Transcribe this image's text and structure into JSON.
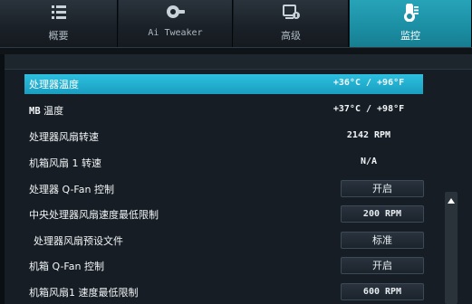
{
  "tabs": [
    {
      "label": "概要",
      "icon": "list-icon",
      "active": false
    },
    {
      "label": "Ai Tweaker",
      "icon": "tweaker-icon",
      "active": false
    },
    {
      "label": "高级",
      "icon": "advanced-icon",
      "active": false
    },
    {
      "label": "监控",
      "icon": "thermometer-icon",
      "active": true
    }
  ],
  "rows": [
    {
      "label": "处理器温度",
      "value": "+36°C / +96°F",
      "selected": true
    },
    {
      "label_prefix": "MB",
      "label": " 温度",
      "value": "+37°C / +98°F"
    },
    {
      "label": "处理器风扇转速",
      "value": "2142 RPM"
    },
    {
      "label": "机箱风扇 1 转速",
      "value": "N/A"
    },
    {
      "label": "处理器 Q-Fan 控制",
      "button": "开启"
    },
    {
      "label": "中央处理器风扇速度最低限制",
      "button": "200 RPM"
    },
    {
      "label": "处理器风扇预设文件",
      "button": "标准"
    },
    {
      "label": "机箱 Q-Fan 控制",
      "button": "开启"
    },
    {
      "label": "机箱风扇1 速度最低限制",
      "button": "600 RPM"
    }
  ],
  "colors": {
    "accent": "#1b8ea3",
    "selected_row": "#2cc0e0",
    "background": "#161d24"
  }
}
